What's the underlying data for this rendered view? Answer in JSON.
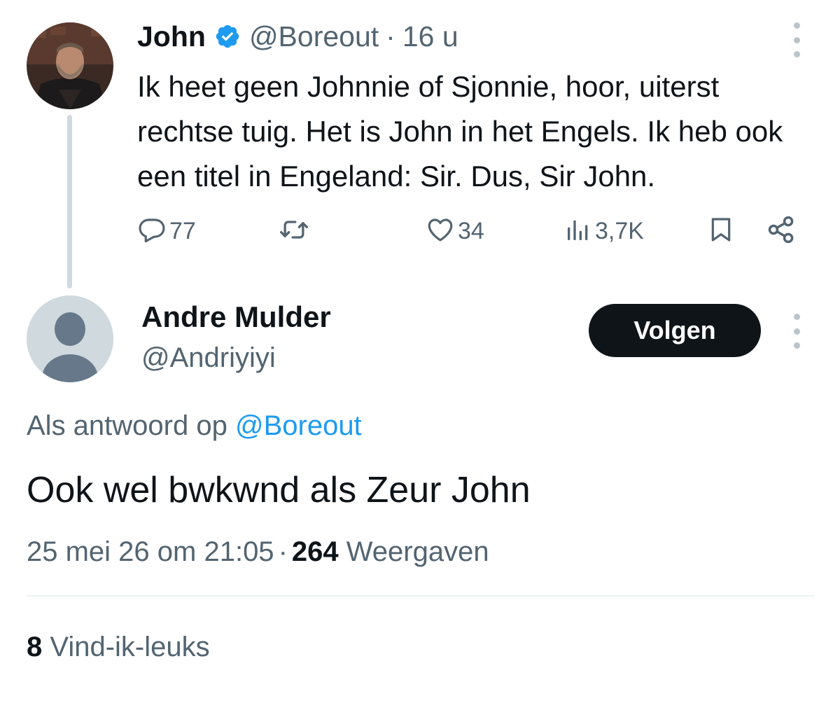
{
  "parent_tweet": {
    "author_name": "John",
    "verified": true,
    "handle": "@Boreout",
    "separator": "·",
    "time": "16 u",
    "text": "Ik heet geen Johnnie of Sjonnie, hoor, uiterst rechtse tuig. Het is John in het Engels. Ik heb ook een titel in Engeland: Sir. Dus, Sir John.",
    "actions": {
      "replies": "77",
      "retweets": "",
      "likes": "34",
      "views": "3,7K"
    },
    "icons": [
      "reply-icon",
      "retweet-icon",
      "like-icon",
      "views-icon",
      "bookmark-icon",
      "share-icon",
      "more-icon",
      "verified-badge-icon"
    ]
  },
  "reply_tweet": {
    "author_name": "Andre Mulder",
    "handle": "@Andriyiyi",
    "follow_label": "Volgen",
    "reply_prefix": "Als antwoord op",
    "reply_to_handle": "@Boreout",
    "text": "Ook wel bwkwnd als Zeur John",
    "timestamp": "25 mei 26 om 21:05",
    "separator": "·",
    "views_count": "264",
    "views_label": "Weergaven",
    "likes_count": "8",
    "likes_label": "Vind-ik-leuks"
  },
  "colors": {
    "text_primary": "#0f1419",
    "text_secondary": "#536471",
    "link": "#1d9bf0",
    "verified": "#1d9bf0",
    "button_bg": "#0f1419",
    "thread_line": "#cfd9de"
  }
}
